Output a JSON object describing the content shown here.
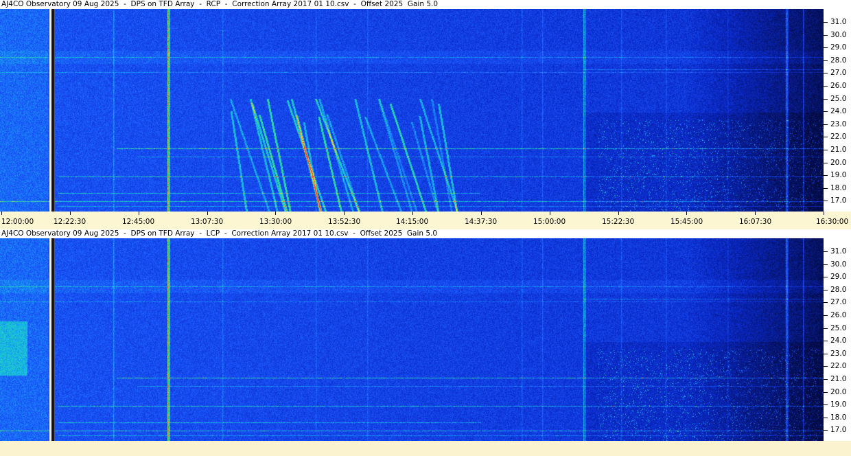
{
  "panels": [
    {
      "id": "rcp",
      "title": "AJ4CO Observatory 09 Aug 2025  -  DPS on TFD Array  -  RCP  -  Correction Array 2017 01 10.csv  -  Offset 2025  Gain 5.0"
    },
    {
      "id": "lcp",
      "title": "AJ4CO Observatory 09 Aug 2025  -  DPS on TFD Array  -  LCP  -  Correction Array 2017 01 10.csv  -  Offset 2025  Gain 5.0"
    }
  ],
  "frequency_labels": [
    "31.0",
    "30.0",
    "29.0",
    "28.0",
    "27.0",
    "26.0",
    "25.0",
    "24.0",
    "23.0",
    "22.0",
    "21.0",
    "20.0",
    "19.0",
    "18.0",
    "17.0"
  ],
  "time_labels": [
    "12:00:00",
    "12:22:30",
    "12:45:00",
    "13:07:30",
    "13:30:00",
    "13:52:30",
    "14:15:00",
    "14:37:30",
    "15:00:00",
    "15:22:30",
    "15:45:00",
    "16:07:30",
    "16:30:00"
  ],
  "colors": {
    "background_blue": "#1a44d8",
    "deep_blue": "#061a80",
    "axis_bg": "#ffffff",
    "time_axis_bg": "#fdf6d2"
  }
}
